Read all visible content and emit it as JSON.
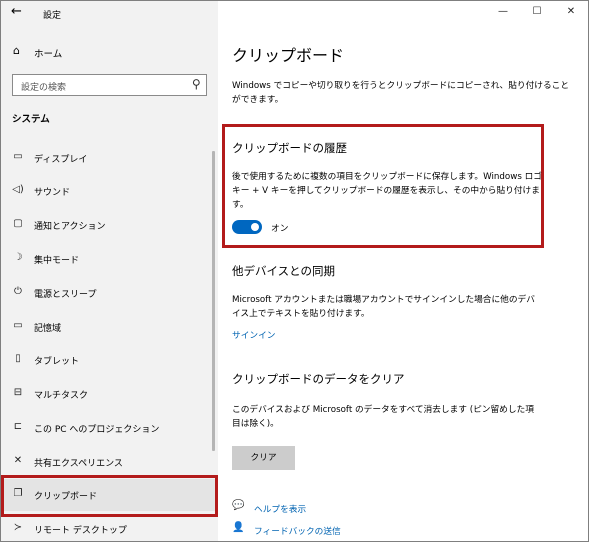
{
  "window": {
    "title": "設定",
    "minimize": "—",
    "maximize": "☐",
    "close": "✕"
  },
  "sidebar": {
    "home_label": "ホーム",
    "search_placeholder": "設定の検索",
    "section_title": "システム",
    "items": [
      {
        "label": "ディスプレイ",
        "icon": "display-icon",
        "glyph": "▭"
      },
      {
        "label": "サウンド",
        "icon": "speaker-icon",
        "glyph": "🔈"
      },
      {
        "label": "通知とアクション",
        "icon": "notification-icon",
        "glyph": "▢"
      },
      {
        "label": "集中モード",
        "icon": "moon-icon",
        "glyph": "☽"
      },
      {
        "label": "電源とスリープ",
        "icon": "power-icon",
        "glyph": "⏻"
      },
      {
        "label": "記憶域",
        "icon": "storage-icon",
        "glyph": "▭"
      },
      {
        "label": "タブレット",
        "icon": "tablet-icon",
        "glyph": "▯"
      },
      {
        "label": "マルチタスク",
        "icon": "multitask-icon",
        "glyph": "⊟"
      },
      {
        "label": "この PC へのプロジェクション",
        "icon": "projection-icon",
        "glyph": "⊏"
      },
      {
        "label": "共有エクスペリエンス",
        "icon": "share-icon",
        "glyph": "✕"
      },
      {
        "label": "クリップボード",
        "icon": "clipboard-icon",
        "glyph": "📋"
      },
      {
        "label": "リモート デスクトップ",
        "icon": "remote-desktop-icon",
        "glyph": "≻"
      }
    ]
  },
  "main": {
    "title": "クリップボード",
    "intro": "Windows でコピーや切り取りを行うとクリップボードにコピーされ、貼り付けることができます。",
    "history": {
      "heading": "クリップボードの履歴",
      "description": "後で使用するために複数の項目をクリップボードに保存します。Windows ロゴ キー + V キーを押してクリップボードの履歴を表示し、その中から貼り付けます。",
      "toggle_label": "オン"
    },
    "sync": {
      "heading": "他デバイスとの同期",
      "description": "Microsoft アカウントまたは職場アカウントでサインインした場合に他のデバイス上でテキストを貼り付けます。",
      "signin_link": "サインイン"
    },
    "clear": {
      "heading": "クリップボードのデータをクリア",
      "description": "このデバイスおよび Microsoft のデータをすべて消去します (ピン留めした項目は除く)。",
      "button": "クリア"
    },
    "help_link": "ヘルプを表示",
    "feedback_link": "フィードバックの送信"
  },
  "colors": {
    "accent": "#0067c0",
    "highlight": "#b31b1b",
    "sidebar_bg": "#f2f2f2"
  }
}
